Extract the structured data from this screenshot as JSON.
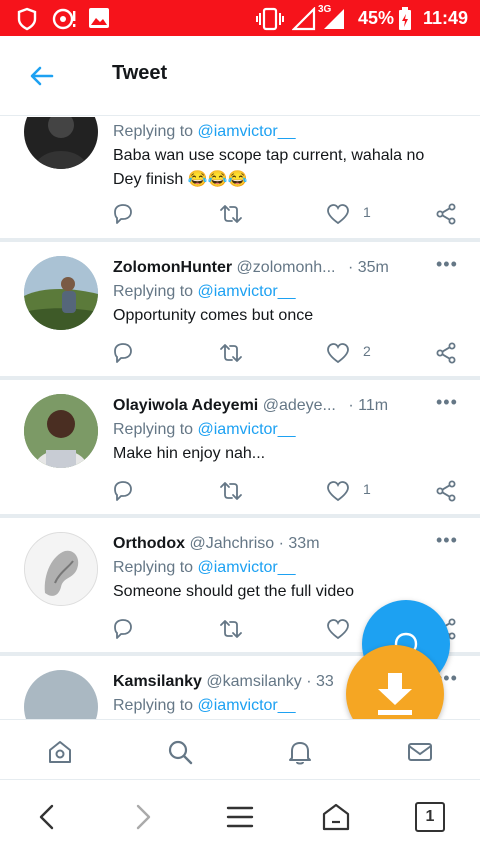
{
  "status_bar": {
    "network": "3G",
    "battery": "45%",
    "time": "11:49"
  },
  "header": {
    "title": "Tweet",
    "back_icon": "arrow-left-icon"
  },
  "tweets": [
    {
      "name": "",
      "handle": "",
      "time": "",
      "replying_label": "Replying to",
      "mention": "@iamvictor__",
      "body_line1": "Baba wan use scope tap current, wahala no",
      "body_line2": "Dey finish 😂😂😂",
      "likes": "1"
    },
    {
      "name": "ZolomonHunter",
      "handle": "@zolomonh...",
      "time": "· 35m",
      "replying_label": "Replying to",
      "mention": "@iamvictor__",
      "body_line1": "Opportunity comes but once",
      "likes": "2"
    },
    {
      "name": "Olayiwola Adeyemi",
      "handle": "@adeye...",
      "time": "· 11m",
      "replying_label": "Replying to",
      "mention": "@iamvictor__",
      "body_line1": "Make hin enjoy nah...",
      "likes": "1"
    },
    {
      "name": "Orthodox",
      "handle": "@Jahchriso",
      "time": "· 33m",
      "replying_label": "Replying to",
      "mention": "@iamvictor__",
      "body_line1": "Someone should get the full video",
      "likes": ""
    },
    {
      "name": "Kamsilanky",
      "handle": "@kamsilanky",
      "time": "· 33",
      "replying_label": "Replying to",
      "mention": "@iamvictor__"
    }
  ],
  "bottom_nav": [
    "home-icon",
    "search-icon",
    "notifications-icon",
    "messages-icon"
  ],
  "browser_bar": {
    "tabs_count": "1"
  },
  "colors": {
    "status_bar": "#f6131b",
    "accent": "#1da1f2",
    "download": "#f5a623"
  }
}
